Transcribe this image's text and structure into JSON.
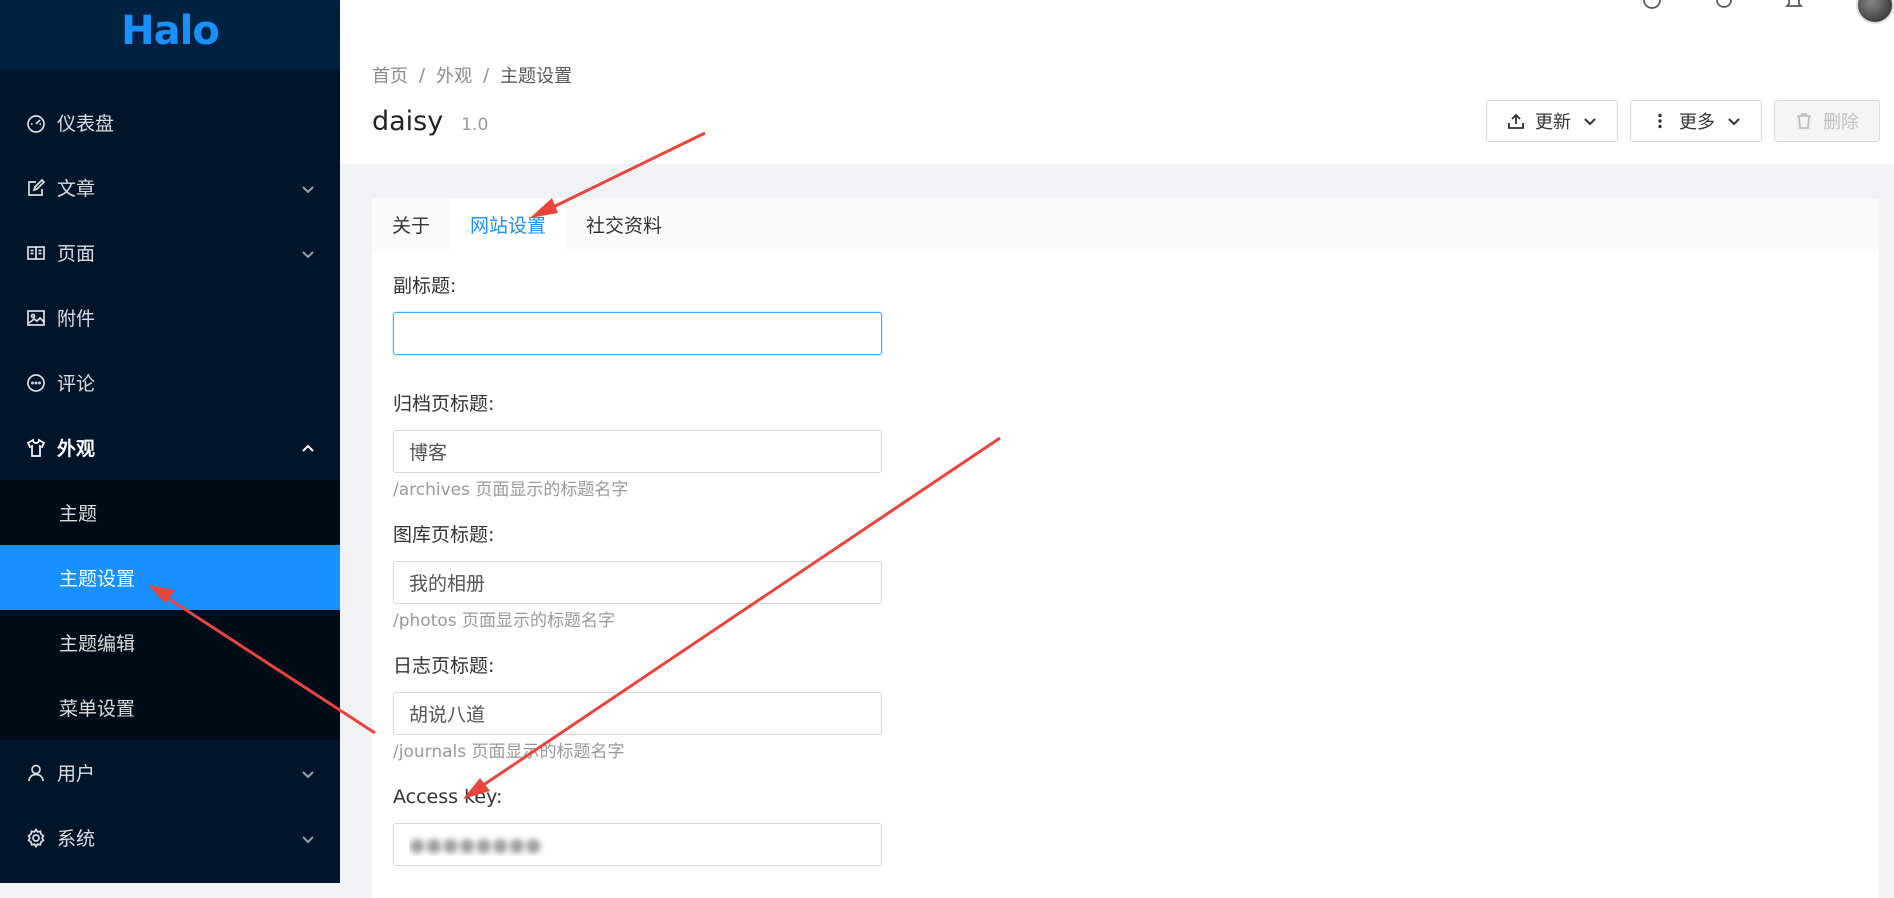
{
  "app": {
    "logo": "Halo"
  },
  "sidebar": {
    "items": [
      {
        "label": "仪表盘",
        "icon": "dashboard-icon",
        "expandable": false
      },
      {
        "label": "文章",
        "icon": "edit-icon",
        "expandable": true
      },
      {
        "label": "页面",
        "icon": "book-icon",
        "expandable": true
      },
      {
        "label": "附件",
        "icon": "picture-icon",
        "expandable": true
      },
      {
        "label": "评论",
        "icon": "message-icon",
        "expandable": false
      },
      {
        "label": "外观",
        "icon": "skin-icon",
        "expandable": true,
        "open": true
      },
      {
        "label": "用户",
        "icon": "user-icon",
        "expandable": true
      },
      {
        "label": "系统",
        "icon": "setting-icon",
        "expandable": true
      }
    ],
    "appearance_sub": [
      {
        "label": "主题"
      },
      {
        "label": "主题设置",
        "active": true
      },
      {
        "label": "主题编辑"
      },
      {
        "label": "菜单设置"
      }
    ]
  },
  "breadcrumb": [
    "首页",
    "外观",
    "主题设置"
  ],
  "page": {
    "title": "daisy",
    "version": "1.0",
    "actions": {
      "update": "更新",
      "more": "更多",
      "delete": "删除"
    }
  },
  "tabs": [
    {
      "label": "关于"
    },
    {
      "label": "网站设置",
      "active": true
    },
    {
      "label": "社交资料"
    }
  ],
  "form": {
    "subtitle": {
      "label": "副标题:",
      "value": ""
    },
    "archives": {
      "label": "归档页标题:",
      "value": "博客",
      "help": "/archives 页面显示的标题名字"
    },
    "photos": {
      "label": "图库页标题:",
      "value": "我的相册",
      "help": "/photos 页面显示的标题名字"
    },
    "journals": {
      "label": "日志页标题:",
      "value": "胡说八道",
      "help": "/journals 页面显示的标题名字"
    },
    "access_key": {
      "label": "Access key:",
      "value": "●●●●●●●●"
    }
  },
  "colors": {
    "sidebar_bg": "#001529",
    "accent": "#1890ff",
    "annotation_arrow": "#e8453c"
  }
}
